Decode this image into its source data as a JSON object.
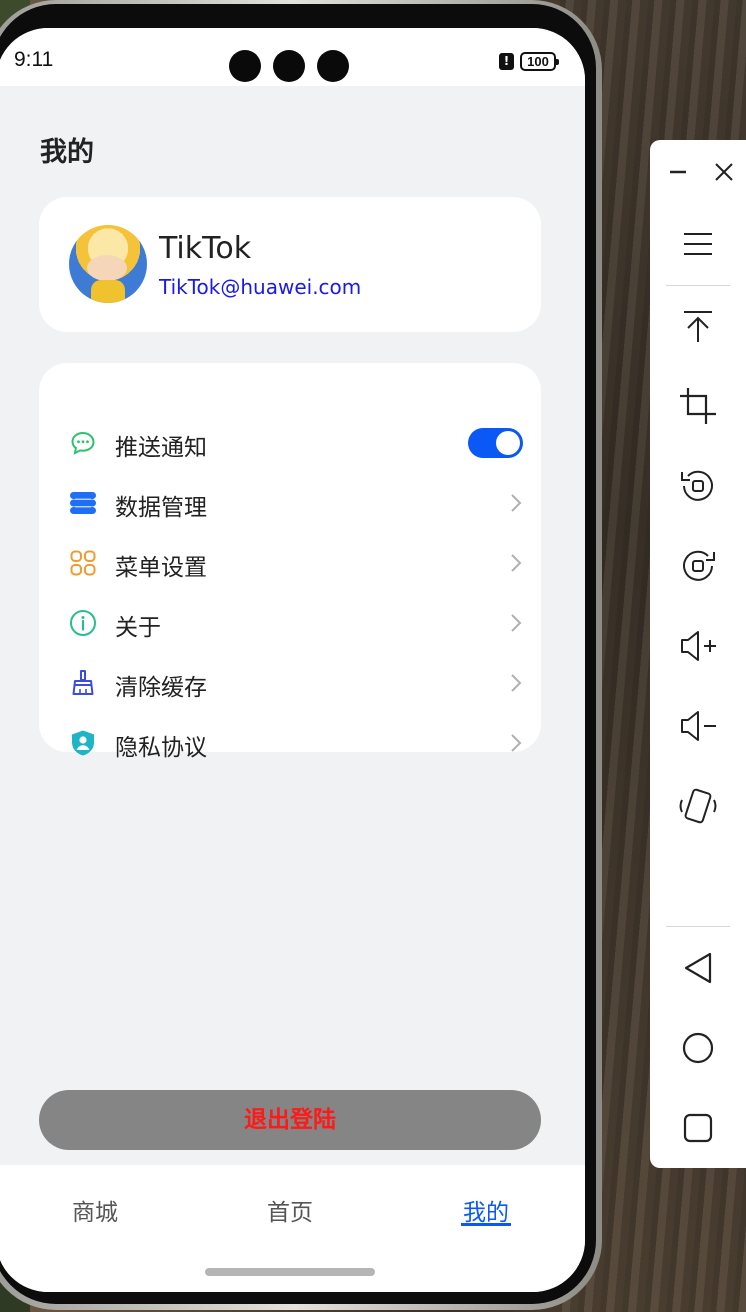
{
  "status_bar": {
    "time": "9:11",
    "battery": "100",
    "alert": "!"
  },
  "page": {
    "title": "我的"
  },
  "profile": {
    "name": "TikTok",
    "email": "TikTok@huawei.com"
  },
  "menu": {
    "items": [
      {
        "label": "推送通知",
        "icon": "message-icon",
        "trailing": "toggle",
        "toggle_on": true
      },
      {
        "label": "数据管理",
        "icon": "database-icon",
        "trailing": "chevron"
      },
      {
        "label": "菜单设置",
        "icon": "grid-icon",
        "trailing": "chevron"
      },
      {
        "label": "关于",
        "icon": "info-icon",
        "trailing": "chevron"
      },
      {
        "label": "清除缓存",
        "icon": "broom-icon",
        "trailing": "chevron"
      },
      {
        "label": "隐私协议",
        "icon": "shield-user-icon",
        "trailing": "chevron"
      }
    ]
  },
  "logout": {
    "label": "退出登陆"
  },
  "tabs": [
    {
      "label": "商城",
      "active": false
    },
    {
      "label": "首页",
      "active": false
    },
    {
      "label": "我的",
      "active": true
    }
  ],
  "colors": {
    "accent": "#0a59f7",
    "logout_text": "#ff1a1a",
    "logout_bg": "#858585",
    "email": "#1a1ae6",
    "page_bg": "#f1f2f4"
  },
  "toolbar": {
    "tools": [
      "minimize-icon",
      "close-icon",
      "menu-icon",
      "pin-top-icon",
      "crop-icon",
      "rotate-left-icon",
      "rotate-right-icon",
      "volume-up-icon",
      "volume-down-icon",
      "shake-icon",
      "back-icon",
      "home-icon",
      "recents-icon"
    ]
  }
}
